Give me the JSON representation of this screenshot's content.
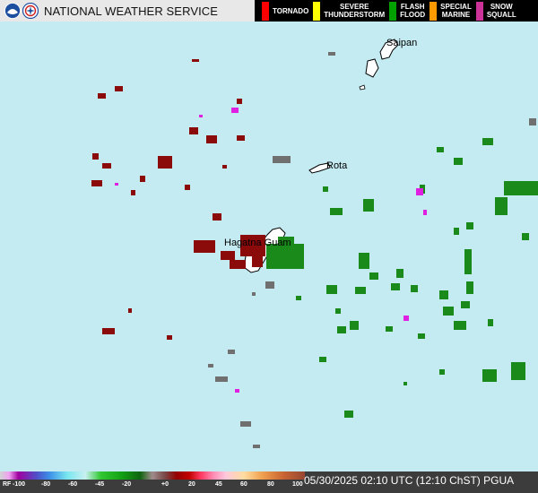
{
  "header": {
    "title": "NATIONAL WEATHER SERVICE",
    "legend": [
      {
        "label1": "TORNADO",
        "label2": "",
        "color": "#ff0000"
      },
      {
        "label1": "SEVERE",
        "label2": "THUNDERSTORM",
        "color": "#ffff00"
      },
      {
        "label1": "FLASH",
        "label2": "FLOOD",
        "color": "#00a000"
      },
      {
        "label1": "SPECIAL",
        "label2": "MARINE",
        "color": "#ff9900"
      },
      {
        "label1": "SNOW",
        "label2": "SQUALL",
        "color": "#cc3399"
      }
    ]
  },
  "map": {
    "background_color": "#c4ebf1",
    "places": [
      {
        "name": "Saipan"
      },
      {
        "name": "Rota"
      },
      {
        "name": "Hagatna Guam"
      }
    ]
  },
  "footer": {
    "scale_prefix": "RF",
    "scale_ticks": [
      "-100",
      "-80",
      "-60",
      "-45",
      "-20",
      "+0",
      "20",
      "45",
      "60",
      "80",
      "100"
    ],
    "timestamp": "05/30/2025 02:10 UTC (12:10 ChST) PGUA"
  }
}
